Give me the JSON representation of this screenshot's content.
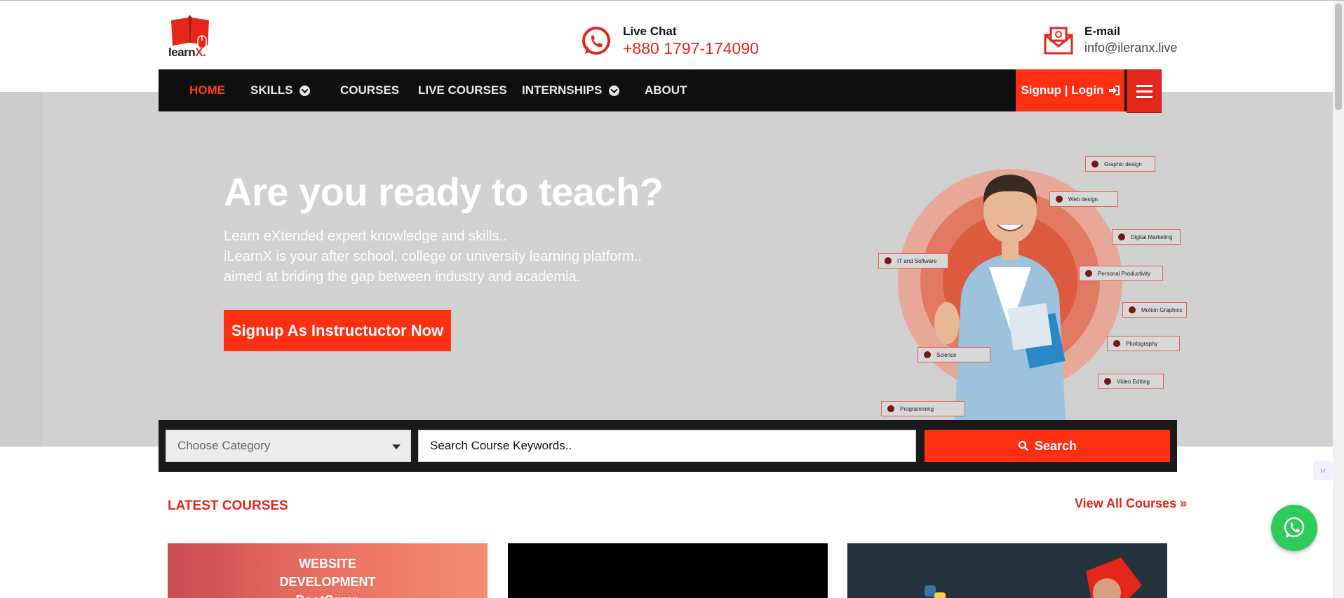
{
  "brand": {
    "logo_text_main": "learn",
    "logo_text_accent": "X."
  },
  "contact": {
    "chat_label": "Live Chat",
    "chat_phone": "+880 1797-174090",
    "email_label": "E-mail",
    "email_value": "info@ileranx.live"
  },
  "nav": {
    "items": [
      {
        "label": "HOME"
      },
      {
        "label": "SKILLS"
      },
      {
        "label": "COURSES"
      },
      {
        "label": "LIVE COURSES"
      },
      {
        "label": "INTERNSHIPS"
      },
      {
        "label": "ABOUT"
      }
    ],
    "signup_label": "Signup | Login"
  },
  "hero": {
    "title": "Are you ready to teach?",
    "line1": "Learn eXtended expert knowledge and skills..",
    "line2": "iLearnX is your after school, college or university learning platform..",
    "line3": "aimed at briding the gap between industry and academia.",
    "cta": "Signup As Instructuctor Now",
    "tags": [
      "Graphic design",
      "Web design",
      "Digital Marketing",
      "IT and Software",
      "Personal Productivity",
      "Motion Graphics",
      "Photography",
      "Science",
      "Video Editing",
      "Programming"
    ]
  },
  "search": {
    "category_placeholder": "Choose Category",
    "keyword_placeholder": "Search Course Keywords..",
    "button_label": "Search"
  },
  "latest": {
    "title": "LATEST COURSES",
    "view_all": "View All Courses »",
    "cards": [
      {
        "title_line1": "WEBSITE",
        "title_line2": "DEVELOPMENT",
        "title_line3": "BootCamp"
      },
      {
        "title_line1": "",
        "title_line2": "",
        "title_line3": ""
      },
      {
        "title_line1": "",
        "title_line2": "",
        "title_line3": ""
      }
    ]
  },
  "colors": {
    "accent": "#ff2f14",
    "nav_bg": "#0f0f0f",
    "hero_bg": "#d1d1d1",
    "whatsapp": "#2ecc5b"
  }
}
